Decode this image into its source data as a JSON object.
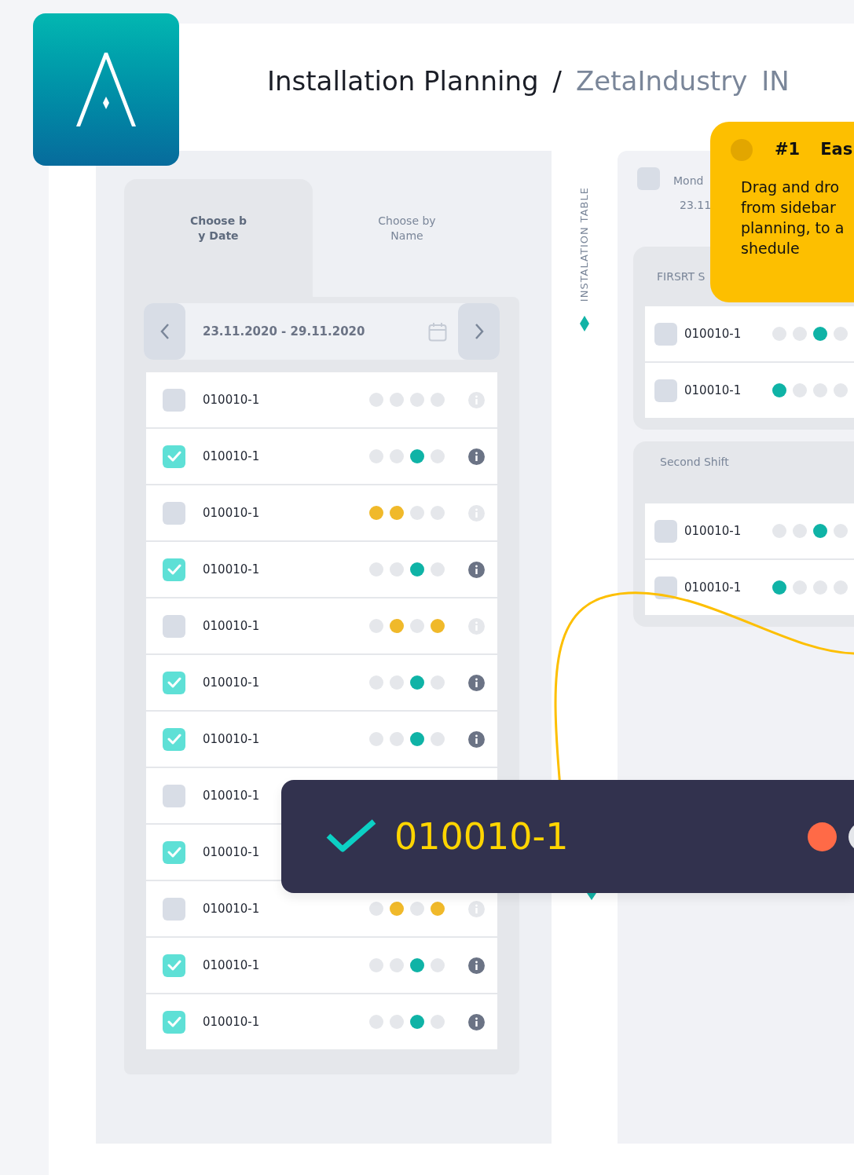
{
  "header": {
    "title": "Installation Planning",
    "separator": "/",
    "company": "ZetaIndustry",
    "company_suffix": "IN"
  },
  "sidebar": {
    "tabs": [
      {
        "label": "Choose b\ny Date",
        "selected": true
      },
      {
        "label": "Choose by\nName",
        "selected": false
      }
    ],
    "date_range": "23.11.2020 - 29.11.2020",
    "rows": [
      {
        "code": "010010-1",
        "checked": false,
        "dots": [
          {
            "color": "#e5e7eb"
          },
          {
            "color": "#e5e7eb"
          },
          {
            "color": "#e5e7eb"
          },
          {
            "color": "#e5e7eb"
          }
        ]
      },
      {
        "code": "010010-1",
        "checked": true,
        "dots": [
          {
            "color": "#e5e7eb"
          },
          {
            "color": "#e5e7eb"
          },
          {
            "color": "#0fb3a6"
          },
          {
            "color": "#e5e7eb"
          }
        ]
      },
      {
        "code": "010010-1",
        "checked": false,
        "dots": [
          {
            "color": "#f0b92a"
          },
          {
            "color": "#f0b92a"
          },
          {
            "color": "#e5e7eb"
          },
          {
            "color": "#e5e7eb"
          }
        ]
      },
      {
        "code": "010010-1",
        "checked": true,
        "dots": [
          {
            "color": "#e5e7eb"
          },
          {
            "color": "#e5e7eb"
          },
          {
            "color": "#0fb3a6"
          },
          {
            "color": "#e5e7eb"
          }
        ]
      },
      {
        "code": "010010-1",
        "checked": false,
        "dots": [
          {
            "color": "#e5e7eb"
          },
          {
            "color": "#f0b92a"
          },
          {
            "color": "#e5e7eb"
          },
          {
            "color": "#f0b92a"
          }
        ]
      },
      {
        "code": "010010-1",
        "checked": true,
        "dots": [
          {
            "color": "#e5e7eb"
          },
          {
            "color": "#e5e7eb"
          },
          {
            "color": "#0fb3a6"
          },
          {
            "color": "#e5e7eb"
          }
        ]
      },
      {
        "code": "010010-1",
        "checked": true,
        "dots": [
          {
            "color": "#e5e7eb"
          },
          {
            "color": "#e5e7eb"
          },
          {
            "color": "#0fb3a6"
          },
          {
            "color": "#e5e7eb"
          }
        ]
      },
      {
        "code": "010010-1",
        "checked": false
      },
      {
        "code": "010010-1",
        "checked": true
      },
      {
        "code": "010010-1",
        "checked": false,
        "dots": [
          {
            "color": "#e5e7eb"
          },
          {
            "color": "#f0b92a"
          },
          {
            "color": "#e5e7eb"
          },
          {
            "color": "#f0b92a"
          }
        ]
      },
      {
        "code": "010010-1",
        "checked": true,
        "dots": [
          {
            "color": "#e5e7eb"
          },
          {
            "color": "#e5e7eb"
          },
          {
            "color": "#0fb3a6"
          },
          {
            "color": "#e5e7eb"
          }
        ]
      },
      {
        "code": "010010-1",
        "checked": true,
        "dots": [
          {
            "color": "#e5e7eb"
          },
          {
            "color": "#e5e7eb"
          },
          {
            "color": "#0fb3a6"
          },
          {
            "color": "#e5e7eb"
          }
        ]
      }
    ]
  },
  "divider_label": "INSTALATION TABLE",
  "table": {
    "checked": false,
    "day": "Mond",
    "date": "23.11",
    "shifts": [
      {
        "title": "FIRSRT S",
        "rows": [
          {
            "code": "010010-1",
            "checked": false,
            "dots": [
              {
                "color": "#e5e7eb"
              },
              {
                "color": "#e5e7eb"
              },
              {
                "color": "#0fb3a6"
              },
              {
                "color": "#e5e7eb"
              }
            ]
          },
          {
            "code": "010010-1",
            "checked": false,
            "dots": [
              {
                "color": "#0fb3a6"
              },
              {
                "color": "#e5e7eb"
              },
              {
                "color": "#e5e7eb"
              },
              {
                "color": "#e5e7eb"
              }
            ]
          }
        ]
      },
      {
        "title": "Second Shift",
        "rows": [
          {
            "code": "010010-1",
            "checked": false,
            "dots": [
              {
                "color": "#e5e7eb"
              },
              {
                "color": "#e5e7eb"
              },
              {
                "color": "#0fb3a6"
              },
              {
                "color": "#e5e7eb"
              }
            ]
          },
          {
            "code": "010010-1",
            "checked": false,
            "dots": [
              {
                "color": "#0fb3a6"
              },
              {
                "color": "#e5e7eb"
              },
              {
                "color": "#e5e7eb"
              },
              {
                "color": "#e5e7eb"
              }
            ]
          }
        ]
      }
    ]
  },
  "tip": {
    "number": "#1",
    "title": "Eas",
    "lines": [
      "Drag and dro",
      "from sidebar",
      "planning, to a",
      "shedule"
    ]
  },
  "drag_card": {
    "code": "010010-1",
    "checked": true,
    "dots": [
      {
        "color": "#ff6a47"
      },
      {
        "color": "#e5e7eb"
      }
    ]
  }
}
